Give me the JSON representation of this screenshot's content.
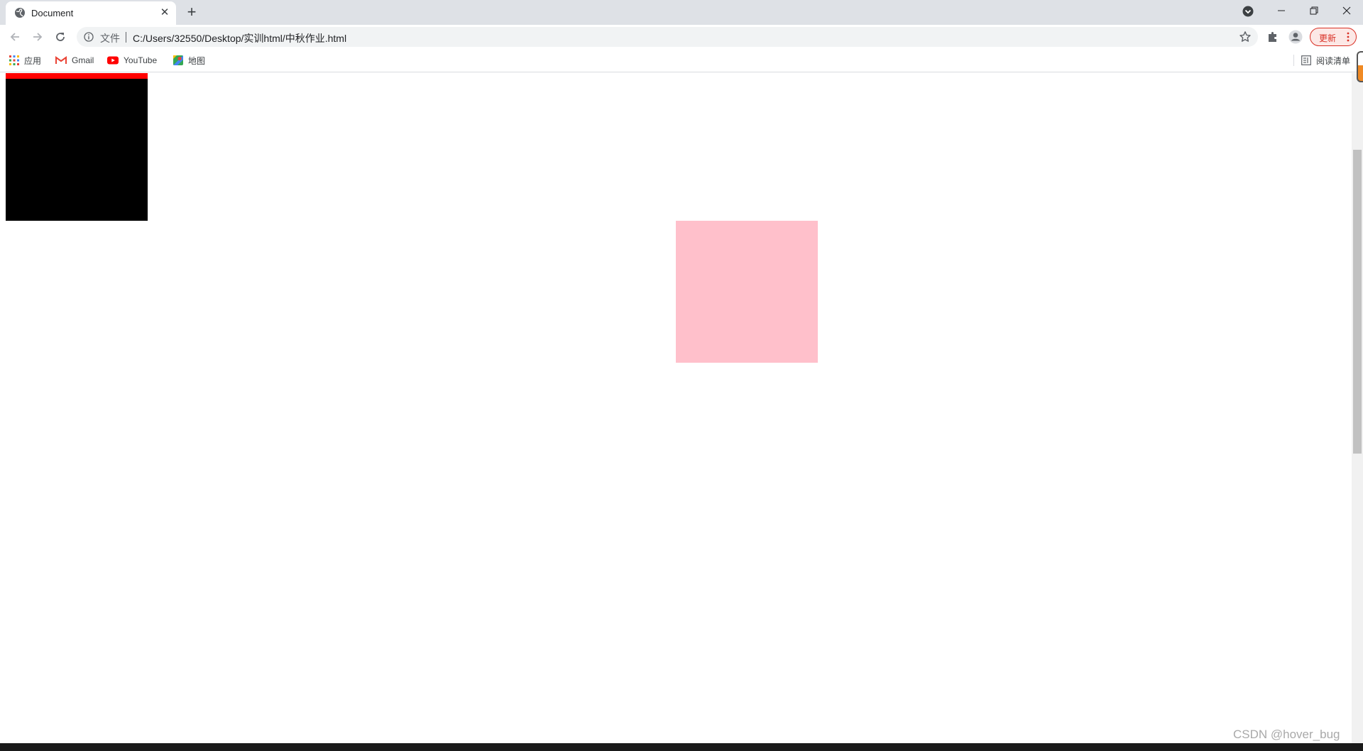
{
  "tab": {
    "title": "Document",
    "favicon": "globe-icon",
    "close_icon": "close-icon",
    "new_tab_icon": "plus-icon"
  },
  "window_controls": [
    "minimize-icon",
    "restore-icon",
    "close-icon"
  ],
  "toolbar": {
    "back_icon": "arrow-left-icon",
    "forward_icon": "arrow-right-icon",
    "reload_icon": "reload-icon",
    "scheme_label": "文件",
    "url": "C:/Users/32550/Desktop/实训html/中秋作业.html",
    "update_label": "更新",
    "update_color": "#d93025"
  },
  "bookmarks": {
    "apps": "应用",
    "gmail": "Gmail",
    "youtube": "YouTube",
    "maps": "地图",
    "reading_list": "阅读清单"
  },
  "content": {
    "black_box_color": "#000000",
    "black_box_border_color": "#ff0000",
    "pink_box_color": "#ffc0cb"
  },
  "watermark": "CSDN @hover_bug"
}
